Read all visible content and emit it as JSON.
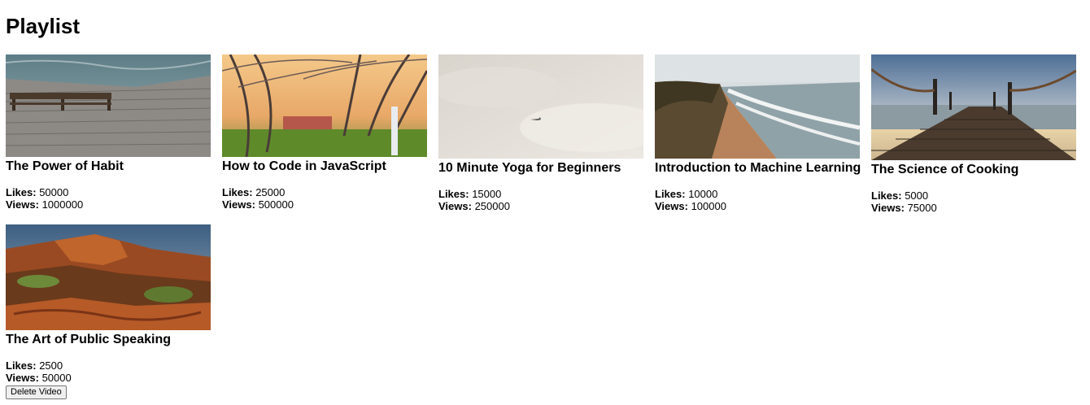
{
  "page": {
    "title": "Playlist"
  },
  "labels": {
    "likes": "Likes:",
    "views": "Views:",
    "delete_button": "Delete Video"
  },
  "videos": [
    {
      "title": "The Power of Habit",
      "likes": "50000",
      "views": "1000000",
      "thumbnail": "wooden-pier-bench"
    },
    {
      "title": "How to Code in JavaScript",
      "likes": "25000",
      "views": "500000",
      "thumbnail": "tree-avenue"
    },
    {
      "title": "10 Minute Yoga for Beginners",
      "likes": "15000",
      "views": "250000",
      "thumbnail": "cloudy-sky-plane"
    },
    {
      "title": "Introduction to Machine Learning",
      "likes": "10000",
      "views": "100000",
      "thumbnail": "coastal-cliff"
    },
    {
      "title": "The Science of Cooking",
      "likes": "5000",
      "views": "75000",
      "thumbnail": "pier-rope-sunset"
    },
    {
      "title": "The Art of Public Speaking",
      "likes": "2500",
      "views": "50000",
      "thumbnail": "red-canyon"
    }
  ]
}
